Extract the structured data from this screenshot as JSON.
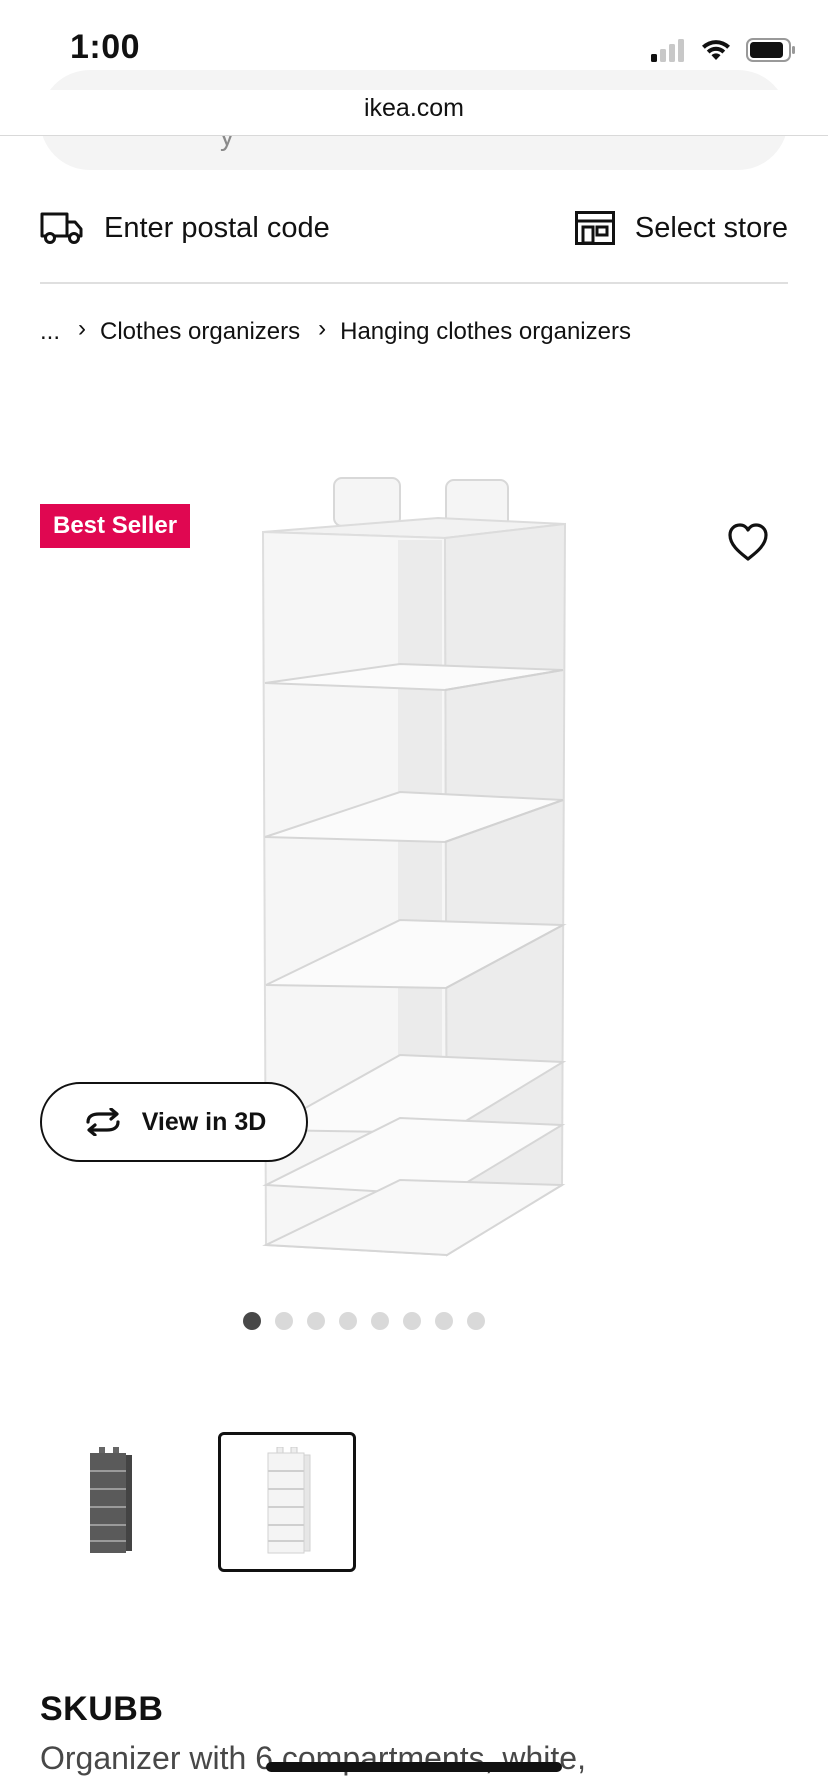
{
  "status_bar": {
    "time": "1:00"
  },
  "browser": {
    "url": "ikea.com"
  },
  "search": {
    "partial_text": "y"
  },
  "delivery": {
    "postal_label": "Enter postal code",
    "store_label": "Select store"
  },
  "breadcrumb": {
    "ellipsis": "...",
    "items": [
      "Clothes organizers",
      "Hanging clothes organizers"
    ]
  },
  "gallery": {
    "badge": "Best Seller",
    "view3d_label": "View in 3D",
    "dots_total": 8,
    "active_dot": 1
  },
  "thumbnails": [
    {
      "name": "gray-variant",
      "selected": false
    },
    {
      "name": "white-variant",
      "selected": true
    }
  ],
  "product": {
    "name": "SKUBB",
    "description": "Organizer with 6 compartments, white,"
  },
  "colors": {
    "badge": "#e00751",
    "text": "#111111",
    "dot_active": "#484848",
    "dot_inactive": "#d9d9d9"
  }
}
